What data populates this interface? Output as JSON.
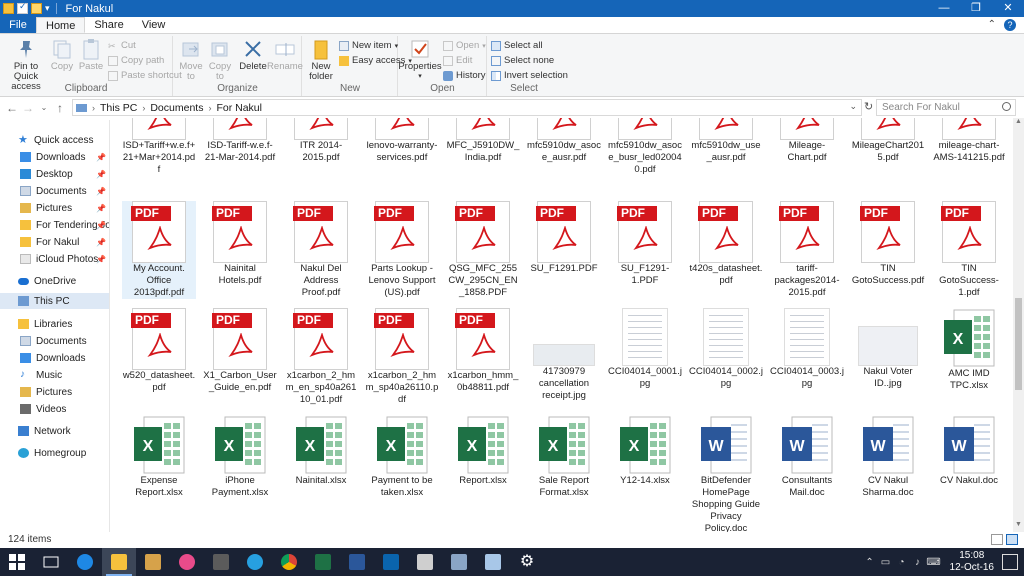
{
  "window": {
    "title": "For Nakul",
    "controls": [
      "—",
      "❐",
      "✕"
    ]
  },
  "tabs": {
    "file": "File",
    "home": "Home",
    "share": "Share",
    "view": "View"
  },
  "ribbon": {
    "clipboard": {
      "label": "Clipboard",
      "pin": "Pin to Quick access",
      "copy": "Copy",
      "paste": "Paste",
      "cut": "Cut",
      "copy_path": "Copy path",
      "paste_shortcut": "Paste shortcut"
    },
    "organize": {
      "label": "Organize",
      "move_to": "Move to",
      "copy_to": "Copy to",
      "delete": "Delete",
      "rename": "Rename"
    },
    "new": {
      "label": "New",
      "new_folder": "New folder",
      "new_item": "New item",
      "easy_access": "Easy access"
    },
    "open": {
      "label": "Open",
      "properties": "Properties",
      "open": "Open",
      "edit": "Edit",
      "history": "History"
    },
    "select": {
      "label": "Select",
      "select_all": "Select all",
      "select_none": "Select none",
      "invert": "Invert selection"
    }
  },
  "address": {
    "crumbs": [
      "This PC",
      "Documents",
      "For Nakul"
    ],
    "search_placeholder": "Search For Nakul"
  },
  "nav": {
    "quick_access": "Quick access",
    "items": [
      "Downloads",
      "Desktop",
      "Documents",
      "Pictures",
      "For Tendering Jol",
      "For Nakul",
      "iCloud Photos"
    ],
    "onedrive": "OneDrive",
    "this_pc": "This PC",
    "libraries": "Libraries",
    "lib_items": [
      "Documents",
      "Downloads",
      "Music",
      "Pictures",
      "Videos"
    ],
    "network": "Network",
    "homegroup": "Homegroup"
  },
  "files": {
    "row0": [
      "ISD+Tariff+w.e.f+21+Mar+2014.pdf",
      "ISD-Tariff-w.e.f-21-Mar-2014.pdf",
      "ITR 2014-2015.pdf",
      "lenovo-warranty-services.pdf",
      "MFC_J5910DW_India.pdf",
      "mfc5910dw_asoce_ausr.pdf",
      "mfc5910dw_asoce_busr_led020040.pdf",
      "mfc5910dw_use_ausr.pdf",
      "Mileage-Chart.pdf",
      "MileageChart2015.pdf",
      "mileage-chart-AMS-141215.pdf"
    ],
    "row1": [
      "My Account. Office 2013pdf.pdf",
      "Nainital Hotels.pdf",
      "Nakul Del Address Proof.pdf",
      "Parts Lookup - Lenovo Support (US).pdf",
      "QSG_MFC_255CW_295CN_EN_1858.PDF",
      "SU_F1291.PDF",
      "SU_F1291-1.PDF",
      "t420s_datasheet.pdf",
      "tariff-packages2014-2015.pdf",
      "TIN GotoSuccess.pdf",
      "TIN GotoSuccess-1.pdf"
    ],
    "row2": [
      "w520_datasheet.pdf",
      "X1_Carbon_User_Guide_en.pdf",
      "x1carbon_2_hmm_en_sp40a26110_01.pdf",
      "x1carbon_2_hmm_sp40a26110.pdf",
      "x1carbon_hmm_0b48811.pdf",
      "41730979 cancellation receipt.jpg",
      "CCI04014_0001.jpg",
      "CCI04014_0002.jpg",
      "CCI04014_0003.jpg",
      "Nakul Voter ID..jpg",
      "AMC IMD TPC.xlsx"
    ],
    "row3": [
      "Expense Report.xlsx",
      "iPhone Payment.xlsx",
      "Nainital.xlsx",
      "Payment to be taken.xlsx",
      "Report.xlsx",
      "Sale Report Format.xlsx",
      "Y12-14.xlsx",
      "BitDefender HomePage Shopping Guide Privacy Policy.doc",
      "Consultants Mail.doc",
      "CV Nakul Sharma.doc",
      "CV Nakul.doc"
    ],
    "pdf_badge": "PDF",
    "xls_letter": "X",
    "doc_letter": "W"
  },
  "status": {
    "count": "124 items"
  },
  "taskbar": {
    "time": "15:08",
    "date": "12-Oct-16"
  },
  "colors": {
    "accent": "#1565b8",
    "pdf_red": "#d4171c",
    "excel_green": "#1e7145",
    "word_blue": "#2b579a"
  }
}
